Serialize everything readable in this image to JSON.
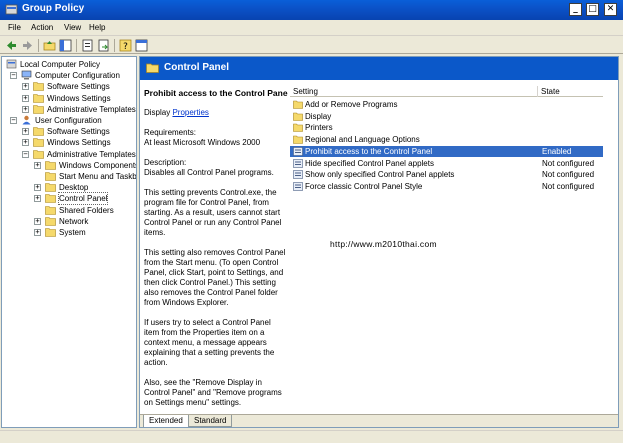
{
  "window": {
    "title": "Group Policy"
  },
  "menu": [
    {
      "label": "File"
    },
    {
      "label": "Action"
    },
    {
      "label": "View"
    },
    {
      "label": "Help"
    }
  ],
  "toolbar": [
    "back-icon",
    "forward-icon",
    "up-folder-icon",
    "show-hide-tree-icon",
    "properties-icon",
    "export-list-icon",
    "help-icon",
    "console-icon"
  ],
  "tree": [
    {
      "label": "Local Computer Policy",
      "level": 0,
      "expander": "",
      "icon": "policy-icon"
    },
    {
      "label": "Computer Configuration",
      "level": 1,
      "expander": "−",
      "icon": "computer-icon"
    },
    {
      "label": "Software Settings",
      "level": 2,
      "expander": "+",
      "icon": "folder-icon"
    },
    {
      "label": "Windows Settings",
      "level": 2,
      "expander": "+",
      "icon": "folder-icon"
    },
    {
      "label": "Administrative Templates",
      "level": 2,
      "expander": "+",
      "icon": "folder-icon"
    },
    {
      "label": "User Configuration",
      "level": 1,
      "expander": "−",
      "icon": "user-icon"
    },
    {
      "label": "Software Settings",
      "level": 2,
      "expander": "+",
      "icon": "folder-icon"
    },
    {
      "label": "Windows Settings",
      "level": 2,
      "expander": "+",
      "icon": "folder-icon"
    },
    {
      "label": "Administrative Templates",
      "level": 2,
      "expander": "−",
      "icon": "folder-icon"
    },
    {
      "label": "Windows Components",
      "level": 3,
      "expander": "+",
      "icon": "folder-icon"
    },
    {
      "label": "Start Menu and Taskba",
      "level": 3,
      "expander": "",
      "icon": "folder-icon"
    },
    {
      "label": "Desktop",
      "level": 3,
      "expander": "+",
      "icon": "folder-icon"
    },
    {
      "label": "Control Panel",
      "level": 3,
      "expander": "+",
      "icon": "folder-open-icon",
      "selected": true
    },
    {
      "label": "Shared Folders",
      "level": 3,
      "expander": "",
      "icon": "folder-icon"
    },
    {
      "label": "Network",
      "level": 3,
      "expander": "+",
      "icon": "folder-icon"
    },
    {
      "label": "System",
      "level": 3,
      "expander": "+",
      "icon": "folder-icon"
    }
  ],
  "header": {
    "title": "Control Panel"
  },
  "description": {
    "title": "Prohibit access to the Control Panel",
    "display_prefix": "Display ",
    "display_link": "Properties",
    "requirements_label": "Requirements:",
    "requirements_value": "At least Microsoft Windows 2000",
    "description_label": "Description:",
    "description_value": "Disables all Control Panel programs.",
    "para1": "This setting prevents Control.exe, the program file for Control Panel, from starting. As a result, users cannot start Control Panel or run any Control Panel items.",
    "para2": "This setting also removes Control Panel from the Start menu. (To open Control Panel, click Start, point to Settings, and then click Control Panel.) This setting also removes the Control Panel folder from Windows Explorer.",
    "para3": "If users try to select a Control Panel item from the Properties item on a context menu, a message appears explaining that a setting prevents the action.",
    "para4": "Also, see the \"Remove Display in Control Panel\" and \"Remove programs on Settings menu\" settings."
  },
  "list": {
    "columns": [
      "Setting",
      "State"
    ],
    "rows": [
      {
        "setting": "Add or Remove Programs",
        "state": "",
        "icon": "folder-icon"
      },
      {
        "setting": "Display",
        "state": "",
        "icon": "folder-icon"
      },
      {
        "setting": "Printers",
        "state": "",
        "icon": "folder-icon"
      },
      {
        "setting": "Regional and Language Options",
        "state": "",
        "icon": "folder-icon"
      },
      {
        "setting": "Prohibit access to the Control Panel",
        "state": "Enabled",
        "icon": "policy-setting-icon",
        "selected": true
      },
      {
        "setting": "Hide specified Control Panel applets",
        "state": "Not configured",
        "icon": "policy-setting-icon"
      },
      {
        "setting": "Show only specified Control Panel applets",
        "state": "Not configured",
        "icon": "policy-setting-icon"
      },
      {
        "setting": "Force classic Control Panel Style",
        "state": "Not configured",
        "icon": "policy-setting-icon"
      }
    ]
  },
  "watermark": "http://www.m2010thai.com",
  "tabs": [
    {
      "label": "Extended",
      "active": true
    },
    {
      "label": "Standard",
      "active": false
    }
  ],
  "colors": {
    "titlebar": "#0a5fd8",
    "header": "#0b58c9",
    "selection": "#316ac5",
    "folder": "#f5d96b"
  }
}
